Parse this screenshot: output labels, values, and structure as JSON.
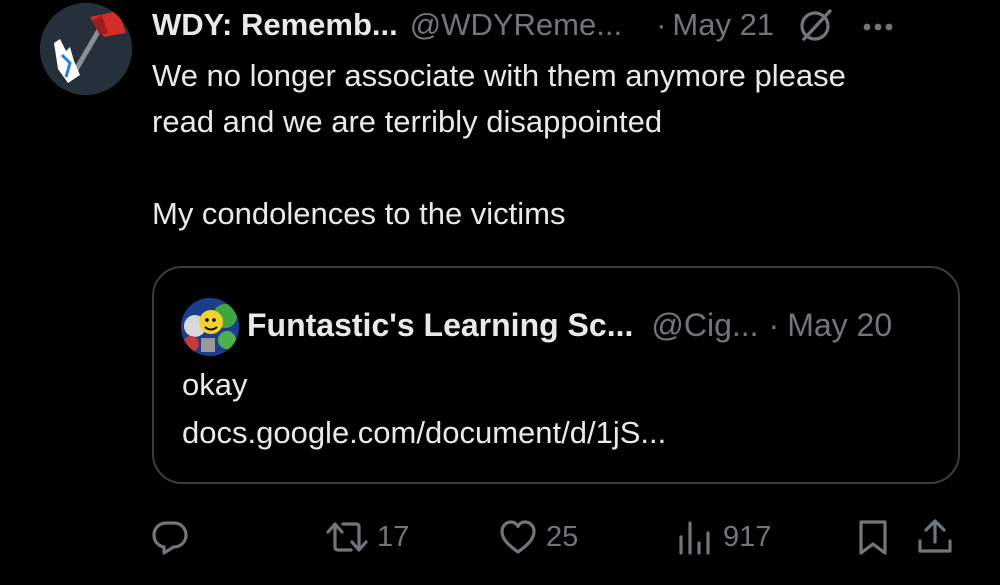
{
  "tweet": {
    "author": {
      "display_name": "WDY: Rememb...",
      "handle": "@WDYReme...",
      "avatar_icon": "axe-hand-avatar"
    },
    "separator": "·",
    "date": "May 21",
    "text_lines": [
      "We no longer associate with them anymore please",
      "read and we are terribly disappointed",
      "My condolences to the victims"
    ]
  },
  "quote": {
    "author": {
      "display_name": "Funtastic's Learning Sc...",
      "handle": "@Cig...",
      "avatar_icon": "cartoon-faces-avatar"
    },
    "separator": "·",
    "date": "May 20",
    "text_lines": [
      "okay",
      "docs.google.com/document/d/1jS..."
    ]
  },
  "actions": {
    "reply": {
      "icon": "reply-icon"
    },
    "retweet": {
      "icon": "retweet-icon",
      "count": "17"
    },
    "like": {
      "icon": "heart-icon",
      "count": "25"
    },
    "views": {
      "icon": "views-icon",
      "count": "917"
    },
    "bookmark": {
      "icon": "bookmark-icon"
    },
    "share": {
      "icon": "share-icon"
    }
  },
  "colors": {
    "background": "#000000",
    "primary_text": "#e7e9ea",
    "secondary_text": "#71767b",
    "card_border": "#3a3d40"
  }
}
